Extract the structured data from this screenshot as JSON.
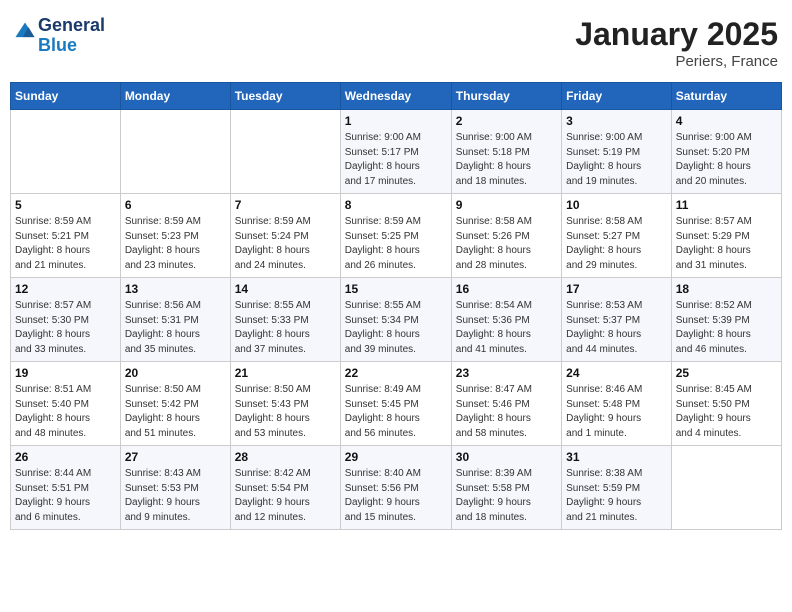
{
  "logo": {
    "line1": "General",
    "line2": "Blue"
  },
  "title": "January 2025",
  "subtitle": "Periers, France",
  "days_of_week": [
    "Sunday",
    "Monday",
    "Tuesday",
    "Wednesday",
    "Thursday",
    "Friday",
    "Saturday"
  ],
  "weeks": [
    [
      {
        "day": "",
        "info": ""
      },
      {
        "day": "",
        "info": ""
      },
      {
        "day": "",
        "info": ""
      },
      {
        "day": "1",
        "info": "Sunrise: 9:00 AM\nSunset: 5:17 PM\nDaylight: 8 hours\nand 17 minutes."
      },
      {
        "day": "2",
        "info": "Sunrise: 9:00 AM\nSunset: 5:18 PM\nDaylight: 8 hours\nand 18 minutes."
      },
      {
        "day": "3",
        "info": "Sunrise: 9:00 AM\nSunset: 5:19 PM\nDaylight: 8 hours\nand 19 minutes."
      },
      {
        "day": "4",
        "info": "Sunrise: 9:00 AM\nSunset: 5:20 PM\nDaylight: 8 hours\nand 20 minutes."
      }
    ],
    [
      {
        "day": "5",
        "info": "Sunrise: 8:59 AM\nSunset: 5:21 PM\nDaylight: 8 hours\nand 21 minutes."
      },
      {
        "day": "6",
        "info": "Sunrise: 8:59 AM\nSunset: 5:23 PM\nDaylight: 8 hours\nand 23 minutes."
      },
      {
        "day": "7",
        "info": "Sunrise: 8:59 AM\nSunset: 5:24 PM\nDaylight: 8 hours\nand 24 minutes."
      },
      {
        "day": "8",
        "info": "Sunrise: 8:59 AM\nSunset: 5:25 PM\nDaylight: 8 hours\nand 26 minutes."
      },
      {
        "day": "9",
        "info": "Sunrise: 8:58 AM\nSunset: 5:26 PM\nDaylight: 8 hours\nand 28 minutes."
      },
      {
        "day": "10",
        "info": "Sunrise: 8:58 AM\nSunset: 5:27 PM\nDaylight: 8 hours\nand 29 minutes."
      },
      {
        "day": "11",
        "info": "Sunrise: 8:57 AM\nSunset: 5:29 PM\nDaylight: 8 hours\nand 31 minutes."
      }
    ],
    [
      {
        "day": "12",
        "info": "Sunrise: 8:57 AM\nSunset: 5:30 PM\nDaylight: 8 hours\nand 33 minutes."
      },
      {
        "day": "13",
        "info": "Sunrise: 8:56 AM\nSunset: 5:31 PM\nDaylight: 8 hours\nand 35 minutes."
      },
      {
        "day": "14",
        "info": "Sunrise: 8:55 AM\nSunset: 5:33 PM\nDaylight: 8 hours\nand 37 minutes."
      },
      {
        "day": "15",
        "info": "Sunrise: 8:55 AM\nSunset: 5:34 PM\nDaylight: 8 hours\nand 39 minutes."
      },
      {
        "day": "16",
        "info": "Sunrise: 8:54 AM\nSunset: 5:36 PM\nDaylight: 8 hours\nand 41 minutes."
      },
      {
        "day": "17",
        "info": "Sunrise: 8:53 AM\nSunset: 5:37 PM\nDaylight: 8 hours\nand 44 minutes."
      },
      {
        "day": "18",
        "info": "Sunrise: 8:52 AM\nSunset: 5:39 PM\nDaylight: 8 hours\nand 46 minutes."
      }
    ],
    [
      {
        "day": "19",
        "info": "Sunrise: 8:51 AM\nSunset: 5:40 PM\nDaylight: 8 hours\nand 48 minutes."
      },
      {
        "day": "20",
        "info": "Sunrise: 8:50 AM\nSunset: 5:42 PM\nDaylight: 8 hours\nand 51 minutes."
      },
      {
        "day": "21",
        "info": "Sunrise: 8:50 AM\nSunset: 5:43 PM\nDaylight: 8 hours\nand 53 minutes."
      },
      {
        "day": "22",
        "info": "Sunrise: 8:49 AM\nSunset: 5:45 PM\nDaylight: 8 hours\nand 56 minutes."
      },
      {
        "day": "23",
        "info": "Sunrise: 8:47 AM\nSunset: 5:46 PM\nDaylight: 8 hours\nand 58 minutes."
      },
      {
        "day": "24",
        "info": "Sunrise: 8:46 AM\nSunset: 5:48 PM\nDaylight: 9 hours\nand 1 minute."
      },
      {
        "day": "25",
        "info": "Sunrise: 8:45 AM\nSunset: 5:50 PM\nDaylight: 9 hours\nand 4 minutes."
      }
    ],
    [
      {
        "day": "26",
        "info": "Sunrise: 8:44 AM\nSunset: 5:51 PM\nDaylight: 9 hours\nand 6 minutes."
      },
      {
        "day": "27",
        "info": "Sunrise: 8:43 AM\nSunset: 5:53 PM\nDaylight: 9 hours\nand 9 minutes."
      },
      {
        "day": "28",
        "info": "Sunrise: 8:42 AM\nSunset: 5:54 PM\nDaylight: 9 hours\nand 12 minutes."
      },
      {
        "day": "29",
        "info": "Sunrise: 8:40 AM\nSunset: 5:56 PM\nDaylight: 9 hours\nand 15 minutes."
      },
      {
        "day": "30",
        "info": "Sunrise: 8:39 AM\nSunset: 5:58 PM\nDaylight: 9 hours\nand 18 minutes."
      },
      {
        "day": "31",
        "info": "Sunrise: 8:38 AM\nSunset: 5:59 PM\nDaylight: 9 hours\nand 21 minutes."
      },
      {
        "day": "",
        "info": ""
      }
    ]
  ]
}
